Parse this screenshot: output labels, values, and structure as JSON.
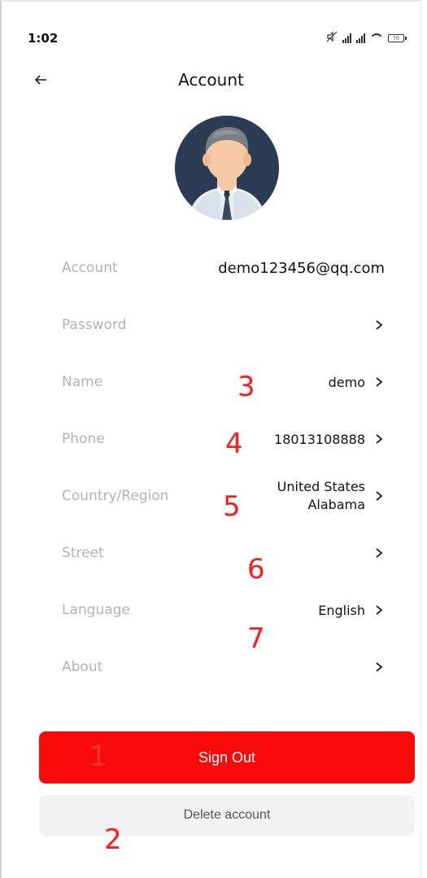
{
  "status_bar": {
    "time": "1:02",
    "battery": "70"
  },
  "header": {
    "title": "Account"
  },
  "rows": [
    {
      "label": "Account",
      "value": "demo123456@qq.com"
    },
    {
      "label": "Password",
      "value": ""
    },
    {
      "label": "Name",
      "value": "demo"
    },
    {
      "label": "Phone",
      "value": "18013108888"
    },
    {
      "label": "Country/Region",
      "value_line1": "United States",
      "value_line2": "Alabama"
    },
    {
      "label": "Street",
      "value": ""
    },
    {
      "label": "Language",
      "value": "English"
    },
    {
      "label": "About",
      "value": ""
    }
  ],
  "buttons": {
    "sign_out": "Sign Out",
    "delete_account": "Delete account"
  },
  "annotations": {
    "a1": "1",
    "a2": "2",
    "a3": "3",
    "a4": "4",
    "a5": "5",
    "a6": "6",
    "a7": "7"
  },
  "colors": {
    "accent": "#fb0a0a",
    "annotation": "#ff1a1a",
    "label": "#b3b3b3"
  }
}
